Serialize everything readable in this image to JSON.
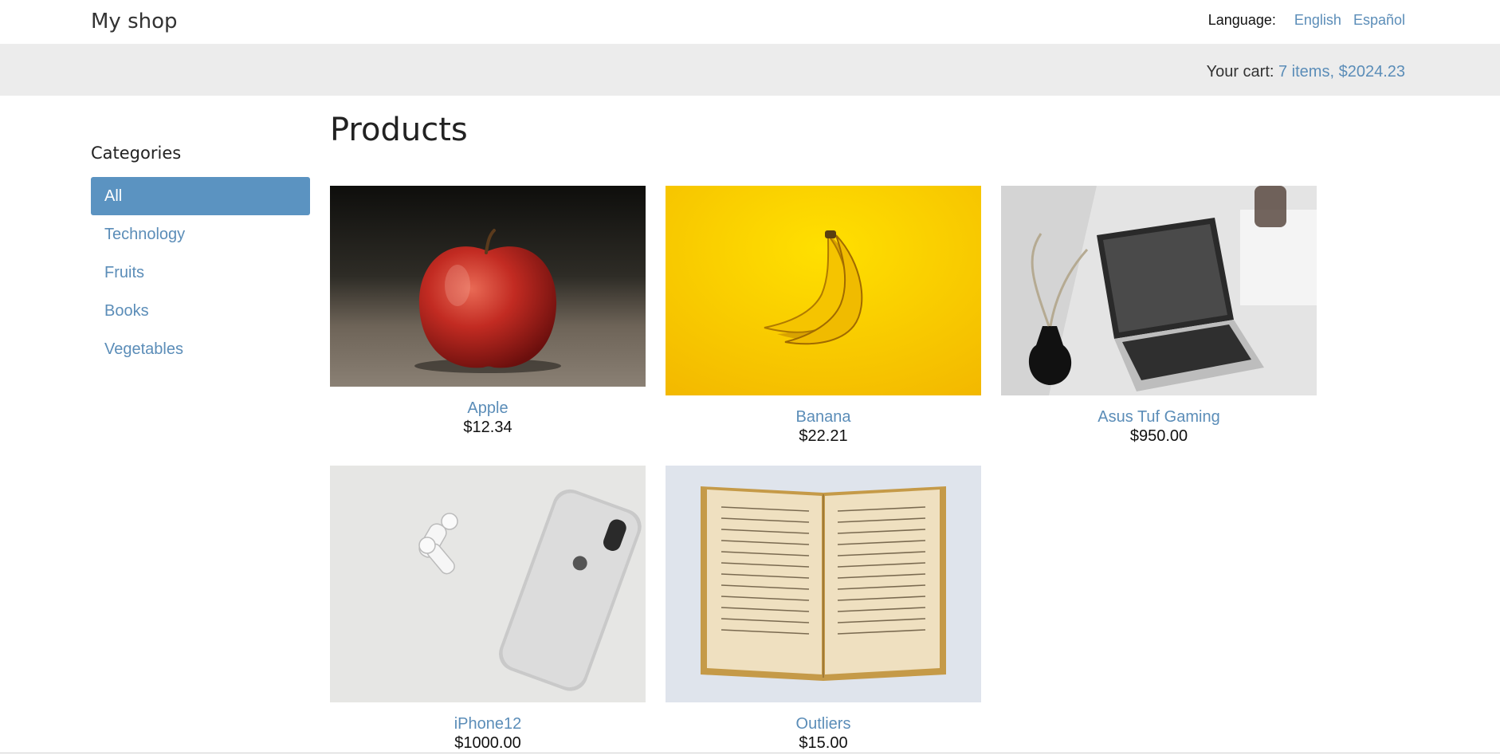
{
  "header": {
    "brand": "My shop",
    "language_label": "Language:",
    "languages": [
      "English",
      "Español"
    ]
  },
  "cart": {
    "label": "Your cart:",
    "summary": "7 items, $2024.23"
  },
  "sidebar": {
    "title": "Categories",
    "items": [
      {
        "label": "All",
        "active": true
      },
      {
        "label": "Technology",
        "active": false
      },
      {
        "label": "Fruits",
        "active": false
      },
      {
        "label": "Books",
        "active": false
      },
      {
        "label": "Vegetables",
        "active": false
      }
    ]
  },
  "main": {
    "title": "Products",
    "products": [
      {
        "name": "Apple",
        "price": "$12.34",
        "image": "apple-photo"
      },
      {
        "name": "Banana",
        "price": "$22.21",
        "image": "banana-photo"
      },
      {
        "name": "Asus Tuf Gaming",
        "price": "$950.00",
        "image": "laptop-photo"
      },
      {
        "name": "iPhone12",
        "price": "$1000.00",
        "image": "iphone-photo"
      },
      {
        "name": "Outliers",
        "price": "$15.00",
        "image": "book-photo"
      }
    ]
  },
  "colors": {
    "link": "#5b8db8",
    "active_category": "#5b93c1",
    "cart_bar": "#ececec"
  }
}
